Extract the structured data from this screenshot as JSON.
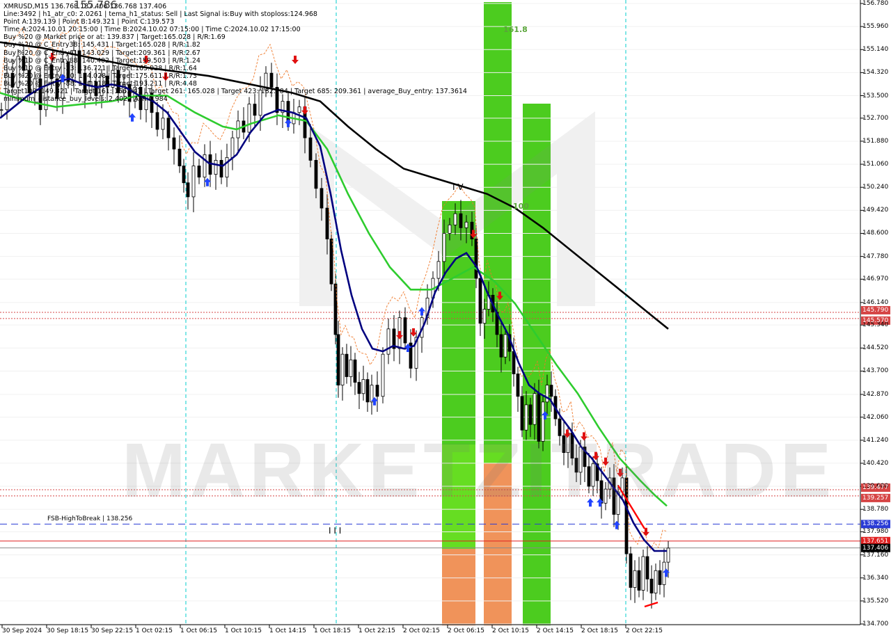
{
  "header": {
    "symbol_line": "XMRUSD,M15  136.768 137.406 136.768 137.406",
    "big_value": "155.786",
    "lines": [
      "Line:3492 | h1_atr_c0: 2.0261 | tema_h1_status: Sell | Last Signal is:Buy with stoploss:124.968",
      "Point A:139.139 | Point B:149.321 | Point C:139.573",
      "Time A:2024.10.01 20:15:00 | Time B:2024.10.02 07:15:00 | Time C:2024.10.02 17:15:00",
      "Buy %20 @ Market price or at: 139.837 | Target:165.028 | R/R:1.69",
      "Buy %20 @ C_Entry38: 145.431 | Target:165.028 | R/R:1.82",
      "Buy %20 @ C_Entry61: 143.029 | Target:209.361 | R/R:2.67",
      "Buy %10 @ C_Entry88: 140.402 | Target:159.503 | R/R:1.24",
      "Buy %10 @ Entry -23: 136.721 | Target:165.028 | R/R:1.64",
      "Buy %20 @ Entry -50: 134.028 | Target:175.611 | R/R:1.73",
      "Buy %20 @ Entry -88: 130.118 | Target:193.211 | R/R:4.48",
      "Target100: 149.321 | Target 161: 156.047 | Target 261: 165.028 | Target 423: 182.784 | Target 685: 209.361 | average_Buy_entry: 137.3614",
      "minimum_distance_buy_levels: 2.402 | ATR:0.984"
    ]
  },
  "watermark": "MARKETZITRADE",
  "y_axis": {
    "ticks": [
      "156.780",
      "155.960",
      "155.140",
      "154.320",
      "153.500",
      "152.700",
      "151.880",
      "151.060",
      "150.240",
      "149.420",
      "148.600",
      "147.780",
      "146.970",
      "146.140",
      "145.340",
      "144.520",
      "143.700",
      "142.870",
      "142.060",
      "141.240",
      "140.420",
      "139.600",
      "138.780",
      "137.980",
      "137.160",
      "136.340",
      "135.520",
      "134.700"
    ]
  },
  "price_tags": [
    {
      "value": "145.790",
      "bg": "#d64545"
    },
    {
      "value": "145.570",
      "bg": "#d64545"
    },
    {
      "value": "139.477",
      "bg": "#d64545"
    },
    {
      "value": "139.257",
      "bg": "#d64545"
    },
    {
      "value": "138.256",
      "bg": "#2a3bd6"
    },
    {
      "value": "137.651",
      "bg": "#e02020"
    },
    {
      "value": "137.406",
      "bg": "#000000"
    }
  ],
  "x_axis": {
    "ticks": [
      "30 Sep 2024",
      "30 Sep 18:15",
      "30 Sep 22:15",
      "1 Oct 02:15",
      "1 Oct 06:15",
      "1 Oct 10:15",
      "1 Oct 14:15",
      "1 Oct 18:15",
      "1 Oct 22:15",
      "2 Oct 02:15",
      "2 Oct 06:15",
      "2 Oct 10:15",
      "2 Oct 14:15",
      "2 Oct 18:15",
      "2 Oct 22:15"
    ]
  },
  "annotations": {
    "fsb_label": "FSB-HighToBreak | 138.256",
    "fib_label": "161.8",
    "fib_label_2": "100",
    "wave_iv": "I V",
    "wave_iii": "I I I"
  },
  "colors": {
    "bullish_zone": "#4ccc1f",
    "bearish_zone": "#f0935a",
    "tema_fast": "#00007f",
    "ma_mid": "#2ecc2e",
    "ma_slow": "#000000",
    "sell_arrow": "#e01010",
    "buy_arrow": "#2244ff"
  },
  "chart_data": {
    "type": "candlestick",
    "symbol": "XMRUSD",
    "timeframe": "M15",
    "last_price": 137.406,
    "ylim": [
      134.7,
      156.78
    ],
    "horizontal_levels": [
      {
        "name": "level_1",
        "value": 145.79,
        "style": "dotted",
        "color": "#d64545"
      },
      {
        "name": "level_2",
        "value": 145.57,
        "style": "dotted",
        "color": "#d64545"
      },
      {
        "name": "level_3",
        "value": 139.477,
        "style": "dotted",
        "color": "#d64545"
      },
      {
        "name": "level_4",
        "value": 139.257,
        "style": "dotted",
        "color": "#d64545"
      },
      {
        "name": "FSB-HighToBreak",
        "value": 138.256,
        "style": "dashed",
        "color": "#2a3bd6"
      },
      {
        "name": "level_6",
        "value": 137.651,
        "style": "solid",
        "color": "#e02020"
      },
      {
        "name": "last",
        "value": 137.406,
        "style": "solid",
        "color": "#888888"
      }
    ],
    "close_path": [
      [
        0,
        153.0
      ],
      [
        8,
        154.3
      ],
      [
        16,
        153.8
      ],
      [
        24,
        154.9
      ],
      [
        32,
        154.4
      ],
      [
        40,
        153.6
      ],
      [
        48,
        154.1
      ],
      [
        56,
        153.0
      ],
      [
        64,
        154.6
      ],
      [
        72,
        154.1
      ],
      [
        80,
        153.4
      ],
      [
        88,
        154.7
      ],
      [
        96,
        154.0
      ],
      [
        104,
        155.1
      ],
      [
        112,
        154.3
      ],
      [
        120,
        153.6
      ],
      [
        128,
        154.0
      ],
      [
        136,
        153.5
      ],
      [
        144,
        154.2
      ],
      [
        152,
        153.8
      ],
      [
        160,
        154.4
      ],
      [
        168,
        153.6
      ],
      [
        176,
        153.9
      ],
      [
        184,
        153.3
      ],
      [
        192,
        153.8
      ],
      [
        200,
        153.0
      ],
      [
        208,
        153.6
      ],
      [
        216,
        152.9
      ],
      [
        224,
        152.3
      ],
      [
        232,
        152.7
      ],
      [
        240,
        152.0
      ],
      [
        248,
        151.6
      ],
      [
        256,
        151.0
      ],
      [
        262,
        150.4
      ],
      [
        268,
        149.9
      ],
      [
        276,
        151.0
      ],
      [
        284,
        150.6
      ],
      [
        292,
        151.4
      ],
      [
        300,
        150.7
      ],
      [
        308,
        151.2
      ],
      [
        316,
        150.6
      ],
      [
        324,
        151.3
      ],
      [
        332,
        152.0
      ],
      [
        340,
        152.6
      ],
      [
        348,
        152.2
      ],
      [
        356,
        153.2
      ],
      [
        364,
        152.8
      ],
      [
        372,
        153.7
      ],
      [
        380,
        154.3
      ],
      [
        388,
        153.8
      ],
      [
        396,
        152.9
      ],
      [
        404,
        153.3
      ],
      [
        412,
        152.5
      ],
      [
        420,
        152.9
      ],
      [
        428,
        153.1
      ],
      [
        436,
        152.0
      ],
      [
        444,
        151.2
      ],
      [
        452,
        150.2
      ],
      [
        460,
        149.5
      ],
      [
        468,
        148.4
      ],
      [
        474,
        146.8
      ],
      [
        480,
        145.0
      ],
      [
        484,
        143.2
      ],
      [
        490,
        144.3
      ],
      [
        496,
        143.5
      ],
      [
        502,
        144.1
      ],
      [
        508,
        143.3
      ],
      [
        514,
        142.9
      ],
      [
        520,
        143.4
      ],
      [
        526,
        142.6
      ],
      [
        532,
        143.2
      ],
      [
        540,
        142.8
      ],
      [
        548,
        144.3
      ],
      [
        556,
        145.2
      ],
      [
        564,
        144.5
      ],
      [
        572,
        145.6
      ],
      [
        580,
        144.7
      ],
      [
        588,
        143.8
      ],
      [
        596,
        144.9
      ],
      [
        604,
        145.6
      ],
      [
        612,
        146.3
      ],
      [
        620,
        147.0
      ],
      [
        628,
        147.6
      ],
      [
        636,
        148.6
      ],
      [
        644,
        148.9
      ],
      [
        652,
        149.3
      ],
      [
        660,
        148.8
      ],
      [
        668,
        149.0
      ],
      [
        676,
        148.4
      ],
      [
        682,
        147.0
      ],
      [
        688,
        145.4
      ],
      [
        694,
        145.9
      ],
      [
        700,
        146.4
      ],
      [
        706,
        145.8
      ],
      [
        712,
        145.0
      ],
      [
        718,
        144.2
      ],
      [
        724,
        145.0
      ],
      [
        730,
        144.4
      ],
      [
        736,
        143.6
      ],
      [
        742,
        142.8
      ],
      [
        748,
        141.6
      ],
      [
        754,
        142.5
      ],
      [
        760,
        141.8
      ],
      [
        766,
        142.9
      ],
      [
        772,
        141.2
      ],
      [
        778,
        142.6
      ],
      [
        784,
        143.2
      ],
      [
        790,
        142.8
      ],
      [
        796,
        142.0
      ],
      [
        802,
        141.4
      ],
      [
        808,
        140.8
      ],
      [
        814,
        141.5
      ],
      [
        820,
        140.6
      ],
      [
        826,
        140.1
      ],
      [
        832,
        141.0
      ],
      [
        838,
        140.3
      ],
      [
        844,
        139.6
      ],
      [
        850,
        140.4
      ],
      [
        856,
        139.8
      ],
      [
        862,
        139.0
      ],
      [
        868,
        139.5
      ],
      [
        874,
        139.9
      ],
      [
        880,
        138.6
      ],
      [
        886,
        139.4
      ],
      [
        892,
        139.9
      ],
      [
        898,
        137.2
      ],
      [
        904,
        136.0
      ],
      [
        910,
        136.6
      ],
      [
        916,
        135.9
      ],
      [
        922,
        137.1
      ],
      [
        928,
        136.3
      ],
      [
        934,
        135.8
      ],
      [
        940,
        136.6
      ],
      [
        946,
        136.1
      ],
      [
        952,
        136.9
      ],
      [
        958,
        137.4
      ]
    ],
    "ma_fast_path": [
      [
        0,
        152.7
      ],
      [
        20,
        153.1
      ],
      [
        40,
        153.5
      ],
      [
        60,
        153.8
      ],
      [
        80,
        154.0
      ],
      [
        100,
        154.1
      ],
      [
        120,
        153.9
      ],
      [
        140,
        153.8
      ],
      [
        160,
        153.9
      ],
      [
        180,
        153.8
      ],
      [
        200,
        153.5
      ],
      [
        220,
        153.3
      ],
      [
        240,
        152.9
      ],
      [
        260,
        152.2
      ],
      [
        280,
        151.5
      ],
      [
        300,
        151.1
      ],
      [
        320,
        151.0
      ],
      [
        340,
        151.4
      ],
      [
        360,
        152.2
      ],
      [
        380,
        152.8
      ],
      [
        400,
        153.0
      ],
      [
        420,
        152.9
      ],
      [
        440,
        152.7
      ],
      [
        460,
        151.7
      ],
      [
        475,
        150.0
      ],
      [
        490,
        148.0
      ],
      [
        505,
        146.4
      ],
      [
        520,
        145.2
      ],
      [
        535,
        144.5
      ],
      [
        550,
        144.4
      ],
      [
        565,
        144.6
      ],
      [
        580,
        144.5
      ],
      [
        595,
        144.6
      ],
      [
        610,
        145.4
      ],
      [
        625,
        146.5
      ],
      [
        640,
        147.2
      ],
      [
        655,
        147.7
      ],
      [
        670,
        147.9
      ],
      [
        685,
        147.4
      ],
      [
        700,
        146.5
      ],
      [
        715,
        145.7
      ],
      [
        730,
        145.0
      ],
      [
        745,
        144.0
      ],
      [
        760,
        143.2
      ],
      [
        775,
        142.9
      ],
      [
        790,
        142.7
      ],
      [
        805,
        142.1
      ],
      [
        820,
        141.6
      ],
      [
        835,
        141.0
      ],
      [
        850,
        140.6
      ],
      [
        865,
        140.1
      ],
      [
        880,
        139.6
      ],
      [
        895,
        139.1
      ],
      [
        910,
        138.3
      ],
      [
        925,
        137.7
      ],
      [
        940,
        137.3
      ],
      [
        958,
        137.3
      ]
    ],
    "ma_mid_path": [
      [
        0,
        153.6
      ],
      [
        40,
        153.3
      ],
      [
        80,
        153.1
      ],
      [
        120,
        153.2
      ],
      [
        160,
        153.3
      ],
      [
        200,
        153.5
      ],
      [
        240,
        153.5
      ],
      [
        280,
        152.9
      ],
      [
        320,
        152.4
      ],
      [
        340,
        152.3
      ],
      [
        360,
        152.5
      ],
      [
        400,
        152.8
      ],
      [
        440,
        152.6
      ],
      [
        470,
        151.6
      ],
      [
        500,
        150.0
      ],
      [
        530,
        148.6
      ],
      [
        560,
        147.4
      ],
      [
        590,
        146.6
      ],
      [
        620,
        146.6
      ],
      [
        650,
        147.0
      ],
      [
        680,
        147.4
      ],
      [
        710,
        146.9
      ],
      [
        740,
        146.1
      ],
      [
        770,
        145.0
      ],
      [
        800,
        143.9
      ],
      [
        830,
        142.9
      ],
      [
        860,
        141.7
      ],
      [
        890,
        140.6
      ],
      [
        920,
        139.8
      ],
      [
        940,
        139.3
      ],
      [
        958,
        138.9
      ]
    ],
    "ma_slow_path": [
      [
        0,
        155.4
      ],
      [
        60,
        155.2
      ],
      [
        120,
        154.9
      ],
      [
        180,
        154.6
      ],
      [
        240,
        154.4
      ],
      [
        300,
        154.2
      ],
      [
        360,
        153.9
      ],
      [
        420,
        153.6
      ],
      [
        460,
        153.3
      ],
      [
        500,
        152.4
      ],
      [
        540,
        151.6
      ],
      [
        580,
        150.9
      ],
      [
        620,
        150.6
      ],
      [
        660,
        150.3
      ],
      [
        700,
        150.0
      ],
      [
        740,
        149.5
      ],
      [
        780,
        148.8
      ],
      [
        820,
        148.0
      ],
      [
        860,
        147.2
      ],
      [
        900,
        146.4
      ],
      [
        940,
        145.6
      ],
      [
        960,
        145.2
      ]
    ]
  }
}
